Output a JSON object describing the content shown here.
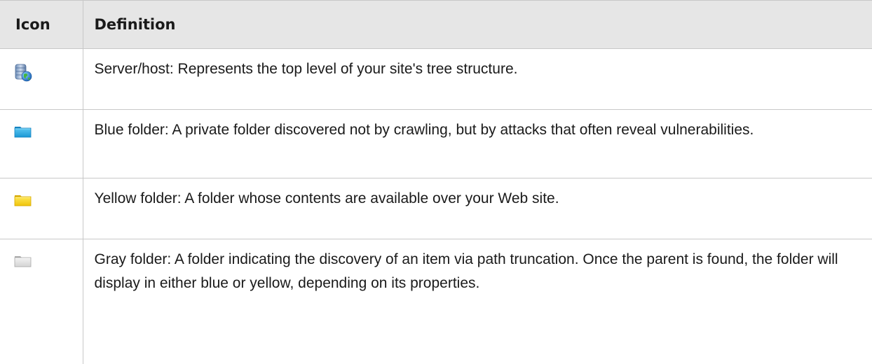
{
  "table": {
    "headers": {
      "icon": "Icon",
      "definition": "Definition"
    },
    "rows": [
      {
        "icon": "server-host-icon",
        "definition": "Server/host: Represents the top level of your site's tree structure."
      },
      {
        "icon": "blue-folder-icon",
        "definition": "Blue folder: A private folder discovered not by crawling, but by attacks that often reveal vulnerabilities."
      },
      {
        "icon": "yellow-folder-icon",
        "definition": "Yellow folder: A folder whose contents are available over your Web site."
      },
      {
        "icon": "gray-folder-icon",
        "definition": "Gray folder: A folder indicating the discovery of an item via path truncation. Once the parent is found, the folder will display in either blue or yellow, depending on its properties."
      }
    ]
  },
  "colors": {
    "header_background": "#e6e6e6",
    "border": "#c8c8c8",
    "blue_folder": "#1fa5dd",
    "yellow_folder": "#f2cf12",
    "gray_folder": "#d9d9d9"
  }
}
